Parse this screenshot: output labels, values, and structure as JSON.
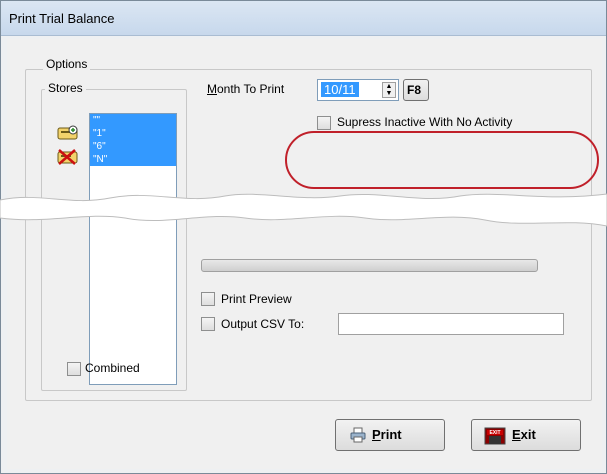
{
  "window": {
    "title": "Print Trial Balance"
  },
  "options": {
    "group_label": "Options",
    "stores": {
      "group_label": "Stores",
      "items": [
        "\"\"",
        "\"1\"",
        "\"6\"",
        "\"N\""
      ],
      "selected_all": true
    },
    "combined": {
      "label": "Combined",
      "checked": false
    },
    "month_to_print": {
      "label": "Month To Print",
      "value": "10/11",
      "hotkey_button": "F8"
    },
    "supress_inactive": {
      "label": "Supress Inactive With No Activity",
      "checked": false
    },
    "print_preview": {
      "label": "Print Preview",
      "checked": false
    },
    "output_csv": {
      "label": "Output CSV To:",
      "checked": false,
      "value": ""
    }
  },
  "buttons": {
    "print": "Print",
    "exit": "Exit"
  },
  "icons": {
    "select_all": "ticket-add-icon",
    "deselect_all": "ticket-remove-icon",
    "print": "printer-icon",
    "exit": "exit-door-icon"
  },
  "colors": {
    "selection": "#3399ff",
    "highlight_oval": "#c0202a"
  }
}
